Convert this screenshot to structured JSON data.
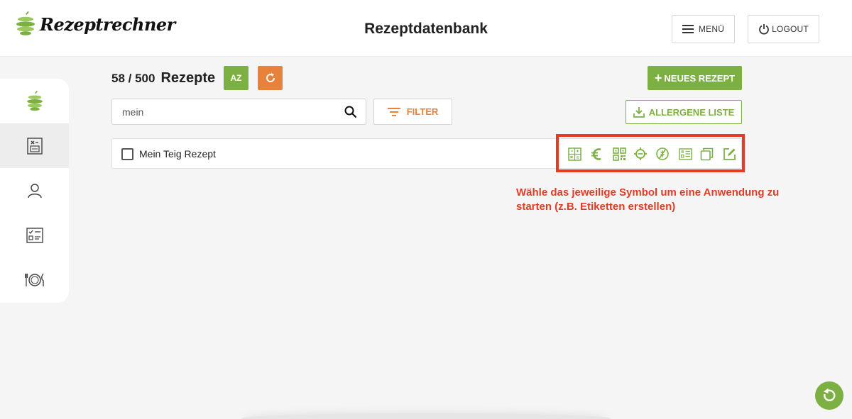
{
  "header": {
    "logo_text": "Rezeptrechner",
    "title": "Rezeptdatenbank",
    "menu_label": "MENÜ",
    "logout_label": "LOGOUT"
  },
  "sidebar": {
    "items": [
      {
        "icon": "apple-logo-icon"
      },
      {
        "icon": "recipe-calculator-icon",
        "active": true
      },
      {
        "icon": "user-icon"
      },
      {
        "icon": "checklist-icon"
      },
      {
        "icon": "dining-plate-icon"
      }
    ]
  },
  "toolbar": {
    "count": "58 / 500",
    "count_label": "Rezepte",
    "sort_label": "AZ",
    "new_recipe_label": "NEUES REZEPT",
    "filter_label": "FILTER",
    "allergen_label": "ALLERGENE LISTE"
  },
  "search": {
    "value": "mein"
  },
  "recipes": [
    {
      "name": "Mein Teig Rezept",
      "checked": false
    }
  ],
  "row_actions": [
    "label-calculator-icon",
    "euro-icon",
    "qr-code-icon",
    "settings-target-icon",
    "no-allergen-icon",
    "spec-sheet-icon",
    "copy-icon",
    "edit-icon"
  ],
  "hint": {
    "text": "Wähle das jeweilige Symbol um eine Anwendung zu starten (z.B. Etiketten erstellen)"
  },
  "colors": {
    "green": "#7cb043",
    "orange": "#e8823a",
    "red": "#e53b24"
  }
}
